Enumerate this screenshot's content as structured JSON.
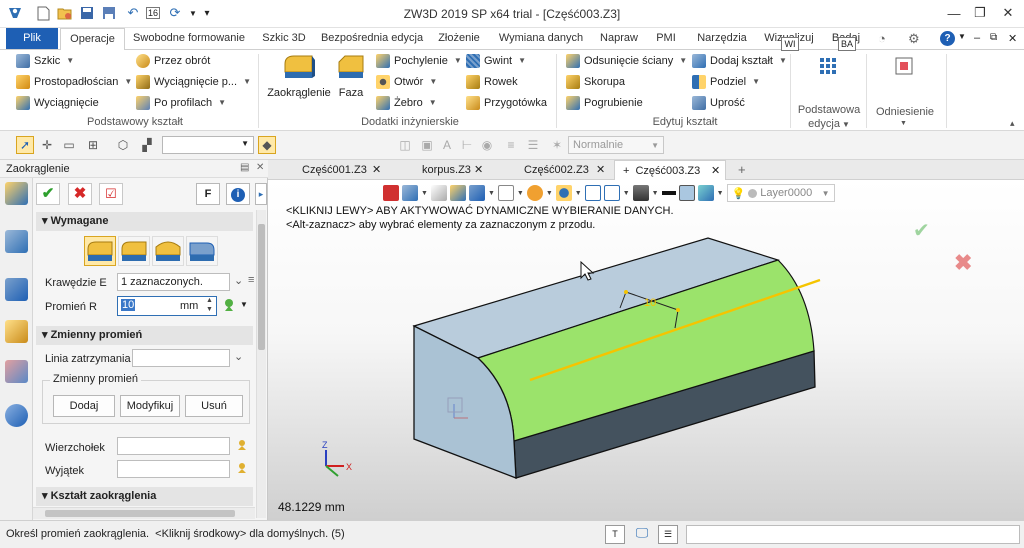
{
  "app": {
    "title": "ZW3D 2019 SP x64 trial - [Część003.Z3]",
    "quick_num": "16"
  },
  "tabs": [
    {
      "label": "Plik"
    },
    {
      "label": "Operacje"
    },
    {
      "label": "Swobodne formowanie"
    },
    {
      "label": "Szkic 3D"
    },
    {
      "label": "Bezpośrednia edycja"
    },
    {
      "label": "Złożenie"
    },
    {
      "label": "Wymiana danych"
    },
    {
      "label": "Napraw"
    },
    {
      "label": "PMI"
    },
    {
      "label": "Narzędzia"
    },
    {
      "label": "Wizualizuj"
    },
    {
      "label": "Badaj"
    }
  ],
  "key_tips": {
    "wi": "WI",
    "ba": "BA"
  },
  "ribbon": {
    "g1": {
      "label": "Podstawowy kształt",
      "items": [
        "Szkic",
        "Prostopadłościan",
        "Wyciągnięcie",
        "Przez obrót",
        "Wyciągnięcie p...",
        "Po profilach"
      ]
    },
    "g2": {
      "label": "Dodatki inżynierskie",
      "big": [
        "Zaokrąglenie",
        "Faza"
      ],
      "items": [
        "Pochylenie",
        "Otwór",
        "Żebro",
        "Gwint",
        "Rowek",
        "Przygotówka"
      ]
    },
    "g3": {
      "label": "Edytuj kształt",
      "items": [
        "Odsunięcie ściany",
        "Skorupa",
        "Pogrubienie",
        "Dodaj kształt",
        "Podziel",
        "Uprość"
      ]
    },
    "g4": {
      "label1": "Podstawowa",
      "label2": "edycja"
    },
    "g5": {
      "label": "Odniesienie"
    }
  },
  "toolbar": {
    "style_value": "Normalnie"
  },
  "panel": {
    "title": "Zaokrąglenie",
    "f_button": "F",
    "required_section": "Wymagane",
    "edges_label": "Krawędzie E",
    "edges_value": "1 zaznaczonych.",
    "radius_label": "Promień R",
    "radius_value": "10",
    "radius_unit": "mm",
    "variable_section": "Zmienny promień",
    "stop_line_label": "Linia zatrzymania",
    "variable_group": "Zmienny promień",
    "add_btn": "Dodaj",
    "modify_btn": "Modyfikuj",
    "delete_btn": "Usuń",
    "vertex_label": "Wierzchołek",
    "exception_label": "Wyjątek",
    "shape_section": "Kształt zaokrąglenia"
  },
  "doc_tabs": [
    {
      "label": "Część001.Z3",
      "active": false
    },
    {
      "label": "korpus.Z3",
      "active": false
    },
    {
      "label": "Część002.Z3",
      "active": false
    },
    {
      "label": "Część003.Z3",
      "active": true
    }
  ],
  "viewport": {
    "hint1": "<KLIKNIJ LEWY> ABY AKTYWOWAĆ DYNAMICZNE WYBIERANIE DANYCH.",
    "hint2": "<Alt-zaznacz> aby wybrać elementy za zaznaczonym z przodu.",
    "layer": "Layer0000",
    "measurement": "48.1229 mm",
    "dimension": "10",
    "colors": {
      "fillet": "#9be36b",
      "body": "#aac2d4",
      "curve": "#f5c400"
    }
  },
  "status": {
    "text": "Określ promień zaokrąglenia.  <Kliknij środkowy> dla domyślnych. (5)"
  }
}
